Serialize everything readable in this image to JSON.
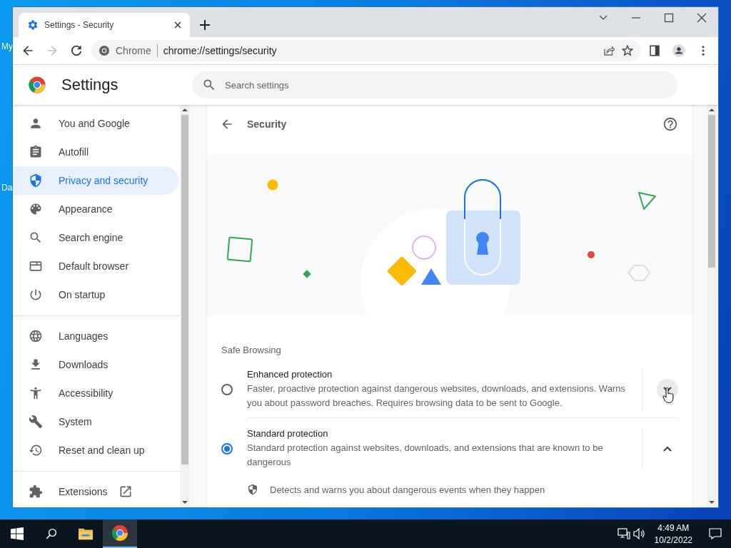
{
  "desktop": {
    "labels": [
      "My",
      "Da"
    ]
  },
  "browser": {
    "tab": {
      "title": "Settings - Security",
      "selected": true
    },
    "omnibox": {
      "site_chip": "Chrome",
      "url": "chrome://settings/security"
    }
  },
  "settings": {
    "title": "Settings",
    "search": {
      "placeholder": "Search settings"
    }
  },
  "sidebar": {
    "groups": [
      {
        "items": [
          {
            "kind": "person",
            "label": "You and Google",
            "selected": false
          },
          {
            "kind": "autofill",
            "label": "Autofill",
            "selected": false
          },
          {
            "kind": "shield",
            "label": "Privacy and security",
            "selected": true
          },
          {
            "kind": "palette",
            "label": "Appearance",
            "selected": false
          },
          {
            "kind": "search",
            "label": "Search engine",
            "selected": false
          },
          {
            "kind": "browser",
            "label": "Default browser",
            "selected": false
          },
          {
            "kind": "power",
            "label": "On startup",
            "selected": false
          }
        ]
      },
      {
        "items": [
          {
            "kind": "globe",
            "label": "Languages",
            "selected": false
          },
          {
            "kind": "download",
            "label": "Downloads",
            "selected": false
          },
          {
            "kind": "accessibility",
            "label": "Accessibility",
            "selected": false
          },
          {
            "kind": "wrench",
            "label": "System",
            "selected": false
          },
          {
            "kind": "restore",
            "label": "Reset and clean up",
            "selected": false
          }
        ]
      },
      {
        "items": [
          {
            "kind": "puzzle",
            "label": "Extensions",
            "selected": false,
            "external": true
          }
        ]
      }
    ]
  },
  "page": {
    "title": "Security",
    "section_title": "Safe Browsing",
    "options": [
      {
        "title": "Enhanced protection",
        "description": "Faster, proactive protection against dangerous websites, downloads, and extensions. Warns you about password breaches. Requires browsing data to be sent to Google.",
        "selected": false,
        "expanded": false,
        "hovered": true
      },
      {
        "title": "Standard protection",
        "description": "Standard protection against websites, downloads, and extensions that are known to be dangerous",
        "selected": true,
        "expanded": true,
        "hovered": false
      }
    ],
    "details": [
      "Detects and warns you about dangerous events when they happen"
    ]
  },
  "taskbar": {
    "time": "4:49 AM",
    "date": "10/2/2022"
  }
}
